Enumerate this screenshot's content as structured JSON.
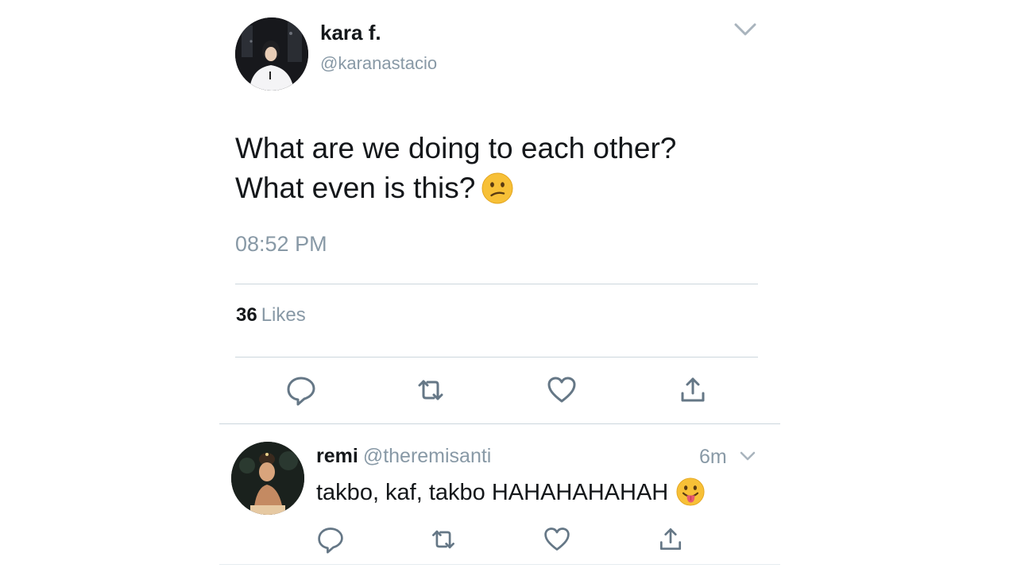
{
  "tweet": {
    "author_name": "kara f.",
    "author_handle": "@karanastacio",
    "text_line_1": "What are we doing to each other?",
    "text_line_2": "What even is this?",
    "text_emoji": "confused-face-emoji",
    "timestamp": "08:52 PM",
    "likes_count": "36",
    "likes_label": "Likes"
  },
  "reply": {
    "author_name": "remi",
    "author_handle": "@theremisanti",
    "time_ago": "6m",
    "text": "takbo, kaf, takbo HAHAHAHAHAH",
    "text_emoji": "tongue-out-emoji"
  },
  "icons": {
    "reply": "reply-icon",
    "retweet": "retweet-icon",
    "like": "heart-icon",
    "share": "share-icon",
    "menu": "chevron-down-icon"
  },
  "colors": {
    "text_primary": "#14171a",
    "text_secondary": "#8899a6",
    "divider": "#ccd6dd",
    "icon": "#657786",
    "emoji_yellow": "#f7c037"
  }
}
